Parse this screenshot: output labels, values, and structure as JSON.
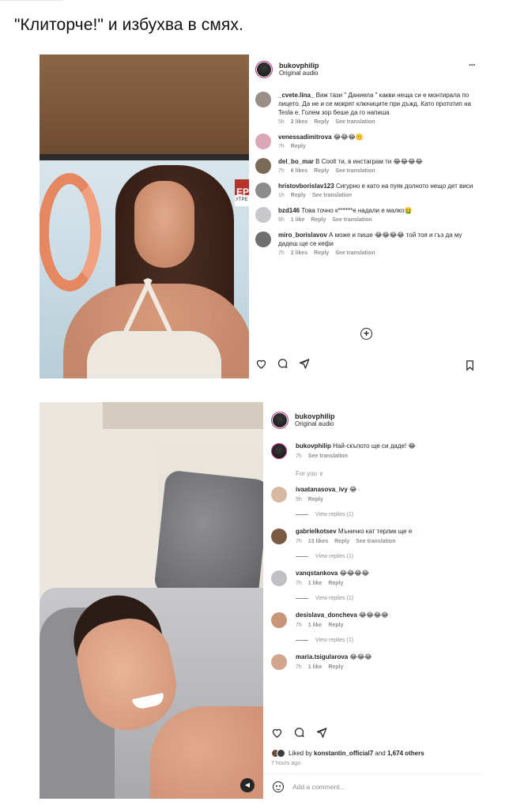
{
  "headline": "\"Клиторче!\" и избухва в смях.",
  "post1": {
    "username": "bukovphilip",
    "audio": "Original audio",
    "more_icon": "more-horizontal-icon",
    "media_tag": "EP",
    "media_tag2": "УТРЕ",
    "comments": [
      {
        "user": "_cvete.lina_",
        "text": "Виж тази \" Даниела \" какви неща си е монтирала по лицето. Да не и се мокрят ключиците при дъжд. Като прототип на Tesla е. Голем зор беше да го напиша",
        "time": "5h",
        "likes": "2 likes",
        "reply": "Reply",
        "translate": "See translation",
        "avatar_color": "#9a8f88"
      },
      {
        "user": "venessadimitrova",
        "text": "😂😂😂🤫",
        "time": "7h",
        "likes": "",
        "reply": "Reply",
        "translate": "",
        "avatar_color": "#d9a7b6"
      },
      {
        "user": "del_bo_mar",
        "text": "В Coolt ти, в инстаграм ти 😂😂😂😂",
        "time": "7h",
        "likes": "6 likes",
        "reply": "Reply",
        "translate": "See translation",
        "avatar_color": "#7a6a55"
      },
      {
        "user": "hristovborislav123",
        "text": "Сигурно е като на пуяк долното нещо дет виси",
        "time": "1h",
        "likes": "",
        "reply": "Reply",
        "translate": "See translation",
        "avatar_color": "#8c8c8c"
      },
      {
        "user": "bzd146",
        "text": "Това точно к******е надали е малко🤮",
        "time": "6h",
        "likes": "1 like",
        "reply": "Reply",
        "translate": "See translation",
        "avatar_color": "#c7c7cc"
      },
      {
        "user": "miro_borislavov",
        "text": "А може и пише 😂😂😂😂 той тоя и гъз да му дадеш ще се кефи",
        "time": "7h",
        "likes": "2 likes",
        "reply": "Reply",
        "translate": "See translation",
        "avatar_color": "#6f6f6f"
      }
    ],
    "plus_label": "+"
  },
  "post2": {
    "username": "bukovphilip",
    "audio": "Original audio",
    "caption": {
      "user": "bukovphilip",
      "text": "Най-скъпото ще си даде! 😂",
      "time": "7h",
      "translate": "See translation"
    },
    "for_you": "For you ∨",
    "view_replies": "View replies (1)",
    "comments": [
      {
        "user": "ivaatanasova_ivy",
        "text": "😂",
        "time": "5h",
        "likes": "",
        "reply": "Reply",
        "translate": "",
        "avatar_color": "#d7b9a2",
        "replies": true
      },
      {
        "user": "gabrielkotsev",
        "text": "Мъничко кат терлик ще е",
        "time": "7h",
        "likes": "13 likes",
        "reply": "Reply",
        "translate": "See translation",
        "avatar_color": "#7b5a43",
        "replies": true
      },
      {
        "user": "vanqstankova",
        "text": "😂😂😂😂",
        "time": "7h",
        "likes": "1 like",
        "reply": "Reply",
        "translate": "",
        "avatar_color": "#bfbfc4",
        "replies": true
      },
      {
        "user": "desislava_doncheva",
        "text": "😂😂😂😂",
        "time": "7h",
        "likes": "1 like",
        "reply": "Reply",
        "translate": "",
        "avatar_color": "#c9967a",
        "replies": true
      },
      {
        "user": "maria.tsigularova",
        "text": "😂😂😂",
        "time": "7h",
        "likes": "1 like",
        "reply": "Reply",
        "translate": "",
        "avatar_color": "#d3a58c",
        "replies": false
      }
    ],
    "liked_by_prefix": "Liked by",
    "liked_by_user": "konstantin_official7",
    "liked_by_and": "and",
    "liked_by_count": "1,674 others",
    "time_ago": "7 hours ago",
    "add_comment_placeholder": "Add a comment..."
  },
  "colors": {
    "ring": "#c13584",
    "muted": "#8e8e8e",
    "text": "#262626"
  }
}
